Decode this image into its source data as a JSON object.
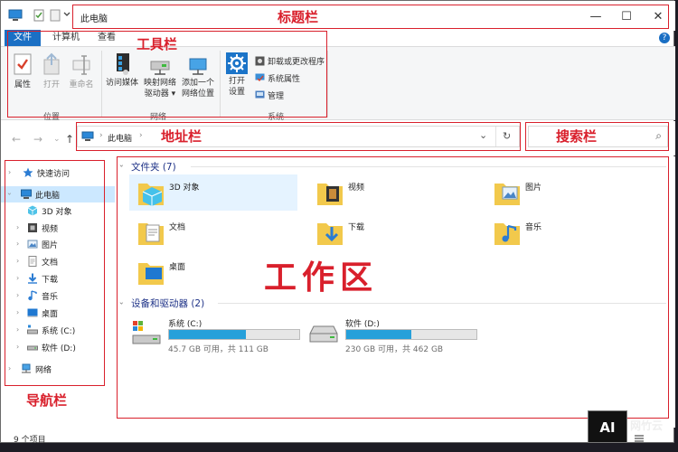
{
  "window": {
    "title": "此电脑",
    "minimize": "—",
    "maximize": "☐",
    "close": "✕"
  },
  "tabs": [
    "文件",
    "计算机",
    "查看"
  ],
  "help": "?",
  "ribbon": {
    "location_group": {
      "label": "位置",
      "buttons": [
        "属性",
        "打开",
        "重命名"
      ]
    },
    "network_group": {
      "label": "网络",
      "buttons": [
        {
          "line1": "访问媒体",
          "line2": ""
        },
        {
          "line1": "映射网络",
          "line2": "驱动器 ▾"
        },
        {
          "line1": "添加一个",
          "line2": "网络位置"
        }
      ]
    },
    "system_group": {
      "label": "系统",
      "open_settings": {
        "line1": "打开",
        "line2": "设置"
      },
      "small": [
        "卸载或更改程序",
        "系统属性",
        "管理"
      ]
    }
  },
  "address": {
    "path": "此电脑",
    "separator": "›",
    "dropdown": "⌄",
    "refresh": "↻"
  },
  "search": {
    "icon_glyph": "⌕"
  },
  "nav": {
    "items": [
      {
        "label": "快速访问",
        "icon": "star-icon"
      },
      {
        "label": "此电脑",
        "icon": "computer-icon"
      },
      {
        "label": "3D 对象",
        "icon": "cube-icon"
      },
      {
        "label": "视频",
        "icon": "video-icon"
      },
      {
        "label": "图片",
        "icon": "picture-icon"
      },
      {
        "label": "文档",
        "icon": "document-icon"
      },
      {
        "label": "下载",
        "icon": "download-icon"
      },
      {
        "label": "音乐",
        "icon": "music-icon"
      },
      {
        "label": "桌面",
        "icon": "desktop-icon"
      },
      {
        "label": "系统 (C:)",
        "icon": "drive-icon"
      },
      {
        "label": "软件 (D:)",
        "icon": "drive-icon"
      },
      {
        "label": "网络",
        "icon": "network-icon"
      }
    ]
  },
  "content": {
    "folders_header": "文件夹 (7)",
    "folders": [
      "3D 对象",
      "视频",
      "图片",
      "文档",
      "下载",
      "音乐",
      "桌面"
    ],
    "devices_header": "设备和驱动器 (2)",
    "drives": [
      {
        "name": "系统 (C:)",
        "detail": "45.7 GB 可用，共 111 GB",
        "used_fraction": 0.59
      },
      {
        "name": "软件 (D:)",
        "detail": "230 GB 可用，共 462 GB",
        "used_fraction": 0.5
      }
    ]
  },
  "status": "9 个项目",
  "annotations": {
    "titlebar": "标题栏",
    "toolbar": "工具栏",
    "addressbar": "地址栏",
    "searchbar": "搜索栏",
    "navbar": "导航栏",
    "workarea": "工作区"
  },
  "watermark": {
    "logo": "AI",
    "text": "网竹云"
  },
  "colors": {
    "accent": "#1a6fc4",
    "annotation": "#d9202c",
    "selection": "#cce8ff",
    "drive_fill": "#26a0da"
  }
}
